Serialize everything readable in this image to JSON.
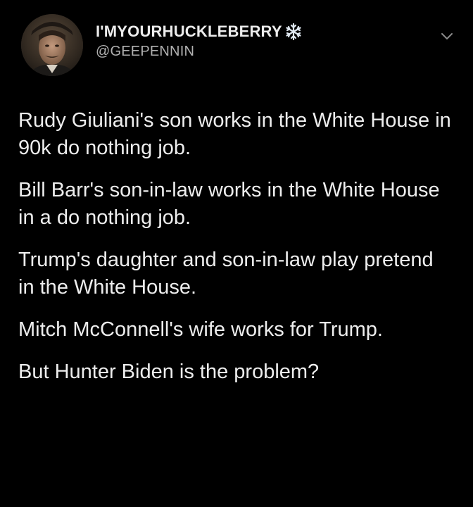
{
  "tweet": {
    "author": {
      "display_name": "I'MYOURHUCKLEBERRY",
      "handle": "@GEEPENNIN",
      "badge_icon": "snowflake-icon",
      "avatar": "profile-photo"
    },
    "menu_icon": "chevron-down-icon",
    "paragraphs": [
      "Rudy Giuliani's son works in the White House in 90k do nothing job.",
      "Bill Barr's son-in-law works in the White House in a do nothing job.",
      "Trump's daughter and son-in-law play pretend in the White House.",
      "Mitch McConnell's wife works for Trump.",
      "But Hunter Biden is the problem?"
    ]
  },
  "colors": {
    "background": "#000000",
    "text_primary": "#ececec",
    "text_secondary": "#b0b0b0"
  }
}
